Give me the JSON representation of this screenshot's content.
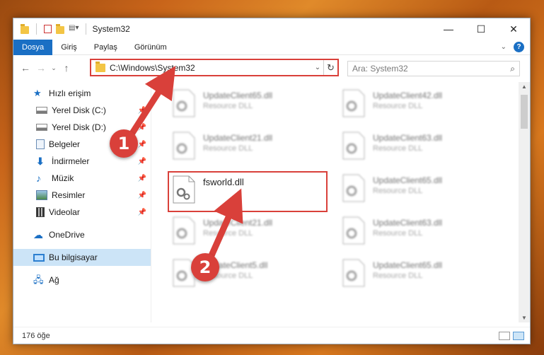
{
  "window": {
    "title": "System32"
  },
  "ribbon": {
    "tabs": [
      "Dosya",
      "Giriş",
      "Paylaş",
      "Görünüm"
    ]
  },
  "address": {
    "path": "C:\\Windows\\System32"
  },
  "search": {
    "placeholder": "Ara: System32"
  },
  "sidebar": {
    "quick_access": "Hızlı erişim",
    "items": [
      {
        "label": "Yerel Disk (C:)",
        "icon": "drive-icon"
      },
      {
        "label": "Yerel Disk (D:)",
        "icon": "drive-icon"
      },
      {
        "label": "Belgeler",
        "icon": "documents-icon"
      },
      {
        "label": "İndirmeler",
        "icon": "downloads-icon"
      },
      {
        "label": "Müzik",
        "icon": "music-icon"
      },
      {
        "label": "Resimler",
        "icon": "pictures-icon"
      },
      {
        "label": "Videolar",
        "icon": "videos-icon"
      }
    ],
    "onedrive": "OneDrive",
    "this_pc": "Bu bilgisayar",
    "network": "Ağ"
  },
  "files": {
    "highlighted": {
      "name": "fsworld.dll"
    },
    "blurred": [
      {
        "name": "UpdateClient65.dll",
        "type": "Resource DLL"
      },
      {
        "name": "UpdateClient42.dll",
        "type": "Resource DLL"
      },
      {
        "name": "UpdateClient21.dll",
        "type": "Resource DLL"
      },
      {
        "name": "UpdateClient63.dll",
        "type": "Resource DLL"
      },
      {
        "name": "UpdateClient65.dll",
        "type": "Resource DLL"
      },
      {
        "name": "UpdateClient21.dll",
        "type": "Resource DLL"
      },
      {
        "name": "UpdateClient63.dll",
        "type": "Resource DLL"
      },
      {
        "name": "UpdateClient5.dll",
        "type": "Resource DLL"
      },
      {
        "name": "UpdateClient65.dll",
        "type": "Resource DLL"
      }
    ]
  },
  "status": {
    "count": "176 öğe"
  },
  "annotations": {
    "step1": "1",
    "step2": "2"
  },
  "colors": {
    "accent": "#1a6fc4",
    "highlight": "#d9403a"
  }
}
